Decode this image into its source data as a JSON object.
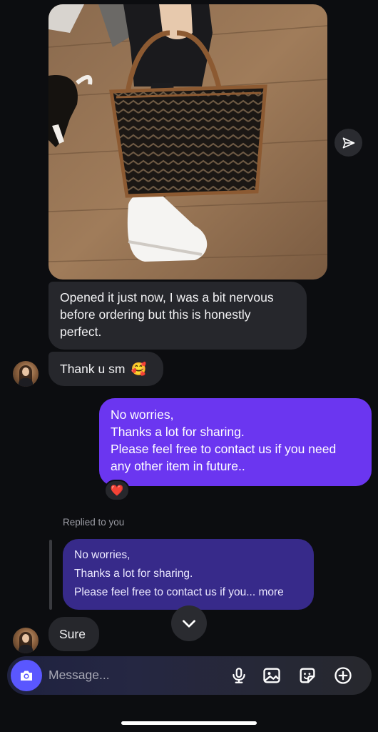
{
  "thread": {
    "incoming_message_1": "Opened it just now, I was a bit nervous before ordering but this is honestly perfect.",
    "incoming_message_2": "Thank u sm",
    "incoming_message_2_emoji": "🥰",
    "outgoing_message": {
      "lines": [
        "No worries,",
        "Thanks a lot for sharing.",
        "Please feel free to contact us if you need",
        "any other item in future.."
      ],
      "reaction": "❤️"
    },
    "reply": {
      "label": "Replied to you",
      "quote_lines": [
        "No worries,",
        "Thanks a lot for sharing.",
        "Please feel free to contact us if you... more"
      ],
      "message": "Sure"
    }
  },
  "composer": {
    "placeholder": "Message..."
  },
  "icons": {
    "share": "paper-plane-icon",
    "scroll_down": "chevron-down-icon",
    "camera": "camera-icon",
    "mic": "microphone-icon",
    "gallery": "image-icon",
    "sticker": "sticker-icon",
    "add": "plus-circle-icon"
  },
  "colors": {
    "background": "#0c0d10",
    "incoming_bubble": "#26272c",
    "outgoing_bubble": "#6b36f0",
    "reply_quote_bubble": "#372a8a",
    "camera_button": "#5a57ff"
  }
}
